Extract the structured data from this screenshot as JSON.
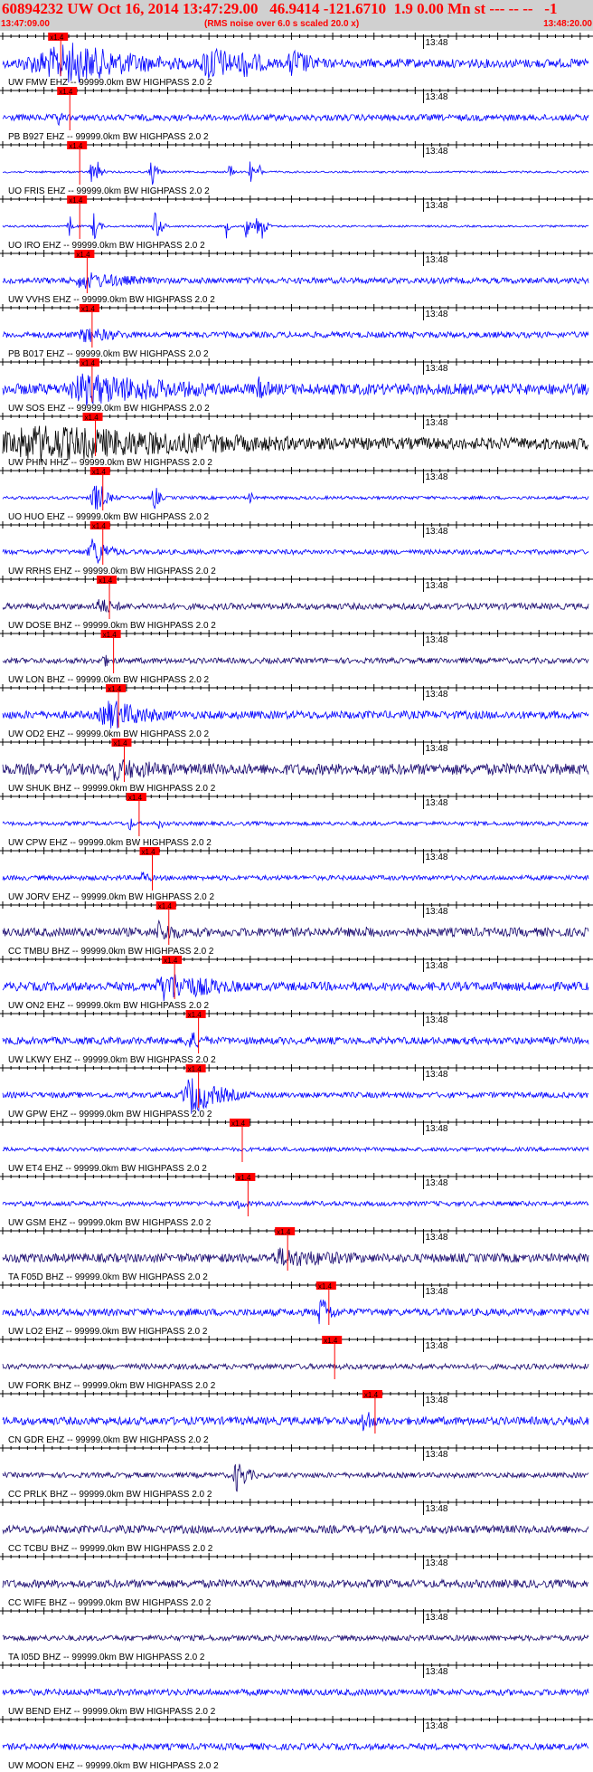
{
  "header": {
    "title": "60894232 UW Oct 16, 2014 13:47:29.00   46.9414 -121.6710  1.9 0.00 Mn st --- -- --   -1",
    "start_time": "13:47:09.00",
    "note": "(RMS noise over 6.0 s scaled 20.0 x)",
    "end_time": "13:48:20.00"
  },
  "colors": {
    "axis": "#000000",
    "pick": "#ff0000",
    "trace_blue": "#0000ff",
    "trace_navy": "#1a0a70",
    "trace_black": "#000000",
    "header_bg": "#d0d0d0"
  },
  "chart_data": {
    "type": "line",
    "x_start": "13:47:09.00",
    "x_end": "13:48:20.00",
    "minute_label": "13:48",
    "pick_label": "x1.4",
    "traces": [
      {
        "label": "UW FMW EHZ -- 99999.0km BW  HIGHPASS  2.0  2",
        "color": "blue",
        "pick_s": 5.5,
        "amp": 0.22,
        "bursts": [
          [
            8.2,
            8.5,
            10.0,
            1.0
          ],
          [
            25.0,
            1.5,
            4.0,
            1.0
          ],
          [
            29.0,
            0.5,
            3.0,
            0.8
          ],
          [
            35.0,
            0.7,
            3.0,
            0.8
          ]
        ]
      },
      {
        "label": "PB B927 EHZ -- 99999.0km BW  HIGHPASS  2.0  2",
        "color": "blue",
        "pick_s": 6.6,
        "amp": 0.16,
        "bursts": [
          [
            6.7,
            0.4,
            0.5,
            0.6
          ]
        ]
      },
      {
        "label": "UO FRIS EHZ -- 99999.0km BW  HIGHPASS  2.0  2",
        "color": "blue",
        "pick_s": 7.8,
        "amp": 0.05,
        "bursts": [
          [
            10.8,
            0.4,
            0.4,
            0.7
          ],
          [
            11.6,
            0.4,
            0.4,
            0.6
          ],
          [
            18.0,
            0.3,
            0.6,
            0.8
          ],
          [
            27.5,
            0.2,
            0.3,
            0.6
          ],
          [
            30.0,
            0.2,
            0.3,
            0.6
          ],
          [
            31.0,
            0.2,
            0.3,
            0.6
          ]
        ]
      },
      {
        "label": "UO IRO EHZ -- 99999.0km BW  HIGHPASS  2.0  2",
        "color": "blue",
        "pick_s": 7.8,
        "amp": 0.05,
        "bursts": [
          [
            8.1,
            0.3,
            0.3,
            0.7
          ],
          [
            11.0,
            0.3,
            0.6,
            0.8
          ],
          [
            18.4,
            0.3,
            0.7,
            0.9
          ],
          [
            27.1,
            0.3,
            0.3,
            0.6
          ],
          [
            29.4,
            0.3,
            0.5,
            0.7
          ],
          [
            30.6,
            0.3,
            0.5,
            0.7
          ],
          [
            31.5,
            0.3,
            0.5,
            0.7
          ]
        ]
      },
      {
        "label": "UW VVHS EHZ -- 99999.0km BW  HIGHPASS  2.0  2",
        "color": "blue",
        "pick_s": 8.7,
        "amp": 0.15,
        "bursts": [
          [
            9.5,
            1.0,
            8.0,
            0.45
          ]
        ]
      },
      {
        "label": "PB B017 EHZ -- 99999.0km BW  HIGHPASS  2.0  2",
        "color": "blue",
        "pick_s": 9.3,
        "amp": 0.15,
        "bursts": [
          [
            9.8,
            1.0,
            6.0,
            0.4
          ]
        ]
      },
      {
        "label": "UW SOS EHZ -- 99999.0km BW  HIGHPASS  2.0  2",
        "color": "blue",
        "pick_s": 9.3,
        "amp": 0.28,
        "bursts": [
          [
            9.8,
            4.0,
            16.0,
            0.8
          ],
          [
            31.0,
            0.5,
            2.0,
            0.6
          ]
        ]
      },
      {
        "label": "UW PHIN HHZ -- 99999.0km BW  HIGHPASS  2.0  2",
        "color": "black",
        "pick_s": 9.7,
        "amp": 0.3,
        "bursts": [
          [
            4.0,
            10.0,
            30.0,
            0.9
          ]
        ]
      },
      {
        "label": "UO HUO EHZ -- 99999.0km BW  HIGHPASS  2.0  2",
        "color": "blue",
        "pick_s": 10.6,
        "amp": 0.08,
        "bursts": [
          [
            10.9,
            0.4,
            1.5,
            0.85
          ],
          [
            12.0,
            0.3,
            0.5,
            0.6
          ],
          [
            18.3,
            0.3,
            0.6,
            0.8
          ],
          [
            30.0,
            0.2,
            0.3,
            0.5
          ]
        ]
      },
      {
        "label": "UW RRHS EHZ -- 99999.0km BW  HIGHPASS  2.0  2",
        "color": "blue",
        "pick_s": 10.6,
        "amp": 0.12,
        "bursts": [
          [
            10.9,
            0.8,
            2.0,
            0.8
          ]
        ]
      },
      {
        "label": "UW DOSE BHZ -- 99999.0km BW  HIGHPASS  2.0  2",
        "color": "navy",
        "pick_s": 11.4,
        "amp": 0.16,
        "bursts": [
          [
            11.6,
            1.0,
            3.0,
            0.45
          ]
        ]
      },
      {
        "label": "UW LON BHZ -- 99999.0km BW  HIGHPASS  2.0  2",
        "color": "navy",
        "pick_s": 11.9,
        "amp": 0.14,
        "bursts": [
          [
            12.0,
            0.6,
            2.0,
            0.35
          ]
        ]
      },
      {
        "label": "UW OD2 EHZ -- 99999.0km BW  HIGHPASS  2.0  2",
        "color": "blue",
        "pick_s": 12.5,
        "amp": 0.2,
        "bursts": [
          [
            12.9,
            2.0,
            6.0,
            0.75
          ]
        ]
      },
      {
        "label": "UW SHUK BHZ -- 99999.0km BW  HIGHPASS  2.0  2",
        "color": "navy",
        "pick_s": 13.2,
        "amp": 0.28,
        "bursts": [
          [
            13.5,
            3.0,
            10.0,
            0.55
          ]
        ]
      },
      {
        "label": "UW CPW EHZ -- 99999.0km BW  HIGHPASS  2.0  2",
        "color": "blue",
        "pick_s": 15.0,
        "amp": 0.1,
        "bursts": [
          [
            15.4,
            0.3,
            0.5,
            0.4
          ],
          [
            19.0,
            0.3,
            0.5,
            0.35
          ]
        ]
      },
      {
        "label": "UW JORV EHZ -- 99999.0km BW  HIGHPASS  2.0  2",
        "color": "blue",
        "pick_s": 16.6,
        "amp": 0.12,
        "bursts": [
          [
            16.9,
            0.4,
            1.0,
            0.4
          ]
        ]
      },
      {
        "label": "CC TMBU BHZ -- 99999.0km BW  HIGHPASS  2.0  2",
        "color": "navy",
        "pick_s": 18.6,
        "amp": 0.22,
        "bursts": [
          [
            19.0,
            1.0,
            3.0,
            0.6
          ],
          [
            44.0,
            0.5,
            2.0,
            0.4
          ]
        ]
      },
      {
        "label": "UW ON2 EHZ -- 99999.0km BW  HIGHPASS  2.0  2",
        "color": "blue",
        "pick_s": 19.3,
        "amp": 0.22,
        "bursts": [
          [
            19.7,
            2.0,
            8.0,
            0.75
          ]
        ]
      },
      {
        "label": "UW LKWY EHZ -- 99999.0km BW  HIGHPASS  2.0  2",
        "color": "blue",
        "pick_s": 22.2,
        "amp": 0.18,
        "bursts": [
          [
            22.6,
            1.0,
            2.5,
            0.5
          ]
        ]
      },
      {
        "label": "UW GPW EHZ -- 99999.0km BW  HIGHPASS  2.0  2",
        "color": "blue",
        "pick_s": 22.2,
        "amp": 0.14,
        "bursts": [
          [
            22.8,
            1.5,
            4.0,
            0.95
          ]
        ]
      },
      {
        "label": "UW ET4 EHZ -- 99999.0km BW  HIGHPASS  2.0  2",
        "color": "blue",
        "pick_s": 27.5,
        "amp": 0.1,
        "bursts": []
      },
      {
        "label": "UW GSM EHZ -- 99999.0km BW  HIGHPASS  2.0  2",
        "color": "blue",
        "pick_s": 28.2,
        "amp": 0.12,
        "bursts": [
          [
            28.6,
            0.6,
            1.5,
            0.3
          ]
        ]
      },
      {
        "label": "TA F05D BHZ -- 99999.0km BW  HIGHPASS  2.0  2",
        "color": "navy",
        "pick_s": 33.0,
        "amp": 0.22,
        "bursts": [
          [
            33.6,
            2.0,
            12.0,
            0.5
          ]
        ]
      },
      {
        "label": "UW LO2 EHZ -- 99999.0km BW  HIGHPASS  2.0  2",
        "color": "blue",
        "pick_s": 38.0,
        "amp": 0.18,
        "bursts": [
          [
            38.5,
            0.6,
            1.5,
            0.85
          ]
        ]
      },
      {
        "label": "UW FORK BHZ -- 99999.0km BW  HIGHPASS  2.0  2",
        "color": "navy",
        "pick_s": 38.7,
        "amp": 0.14,
        "bursts": []
      },
      {
        "label": "CN GDR EHZ -- 99999.0km BW  HIGHPASS  2.0  2",
        "color": "blue",
        "pick_s": 43.6,
        "amp": 0.2,
        "bursts": [
          [
            43.8,
            0.4,
            1.0,
            0.9
          ]
        ]
      },
      {
        "label": "CC PRLK BHZ -- 99999.0km BW  HIGHPASS  2.0  2",
        "color": "navy",
        "pick_s": null,
        "amp": 0.13,
        "bursts": [
          [
            28.3,
            0.5,
            1.5,
            0.85
          ]
        ]
      },
      {
        "label": "CC TCBU BHZ -- 99999.0km BW  HIGHPASS  2.0  2",
        "color": "navy",
        "pick_s": null,
        "amp": 0.2,
        "bursts": []
      },
      {
        "label": "CC WIFE BHZ -- 99999.0km BW  HIGHPASS  2.0  2",
        "color": "navy",
        "pick_s": null,
        "amp": 0.2,
        "bursts": []
      },
      {
        "label": "TA I05D BHZ -- 99999.0km BW  HIGHPASS  2.0  2",
        "color": "navy",
        "pick_s": null,
        "amp": 0.14,
        "bursts": []
      },
      {
        "label": "UW BEND EHZ -- 99999.0km BW  HIGHPASS  2.0  2",
        "color": "blue",
        "pick_s": null,
        "amp": 0.16,
        "bursts": []
      },
      {
        "label": "UW MOON EHZ -- 99999.0km BW  HIGHPASS  2.0  2",
        "color": "blue",
        "pick_s": null,
        "amp": 0.16,
        "bursts": []
      }
    ]
  }
}
